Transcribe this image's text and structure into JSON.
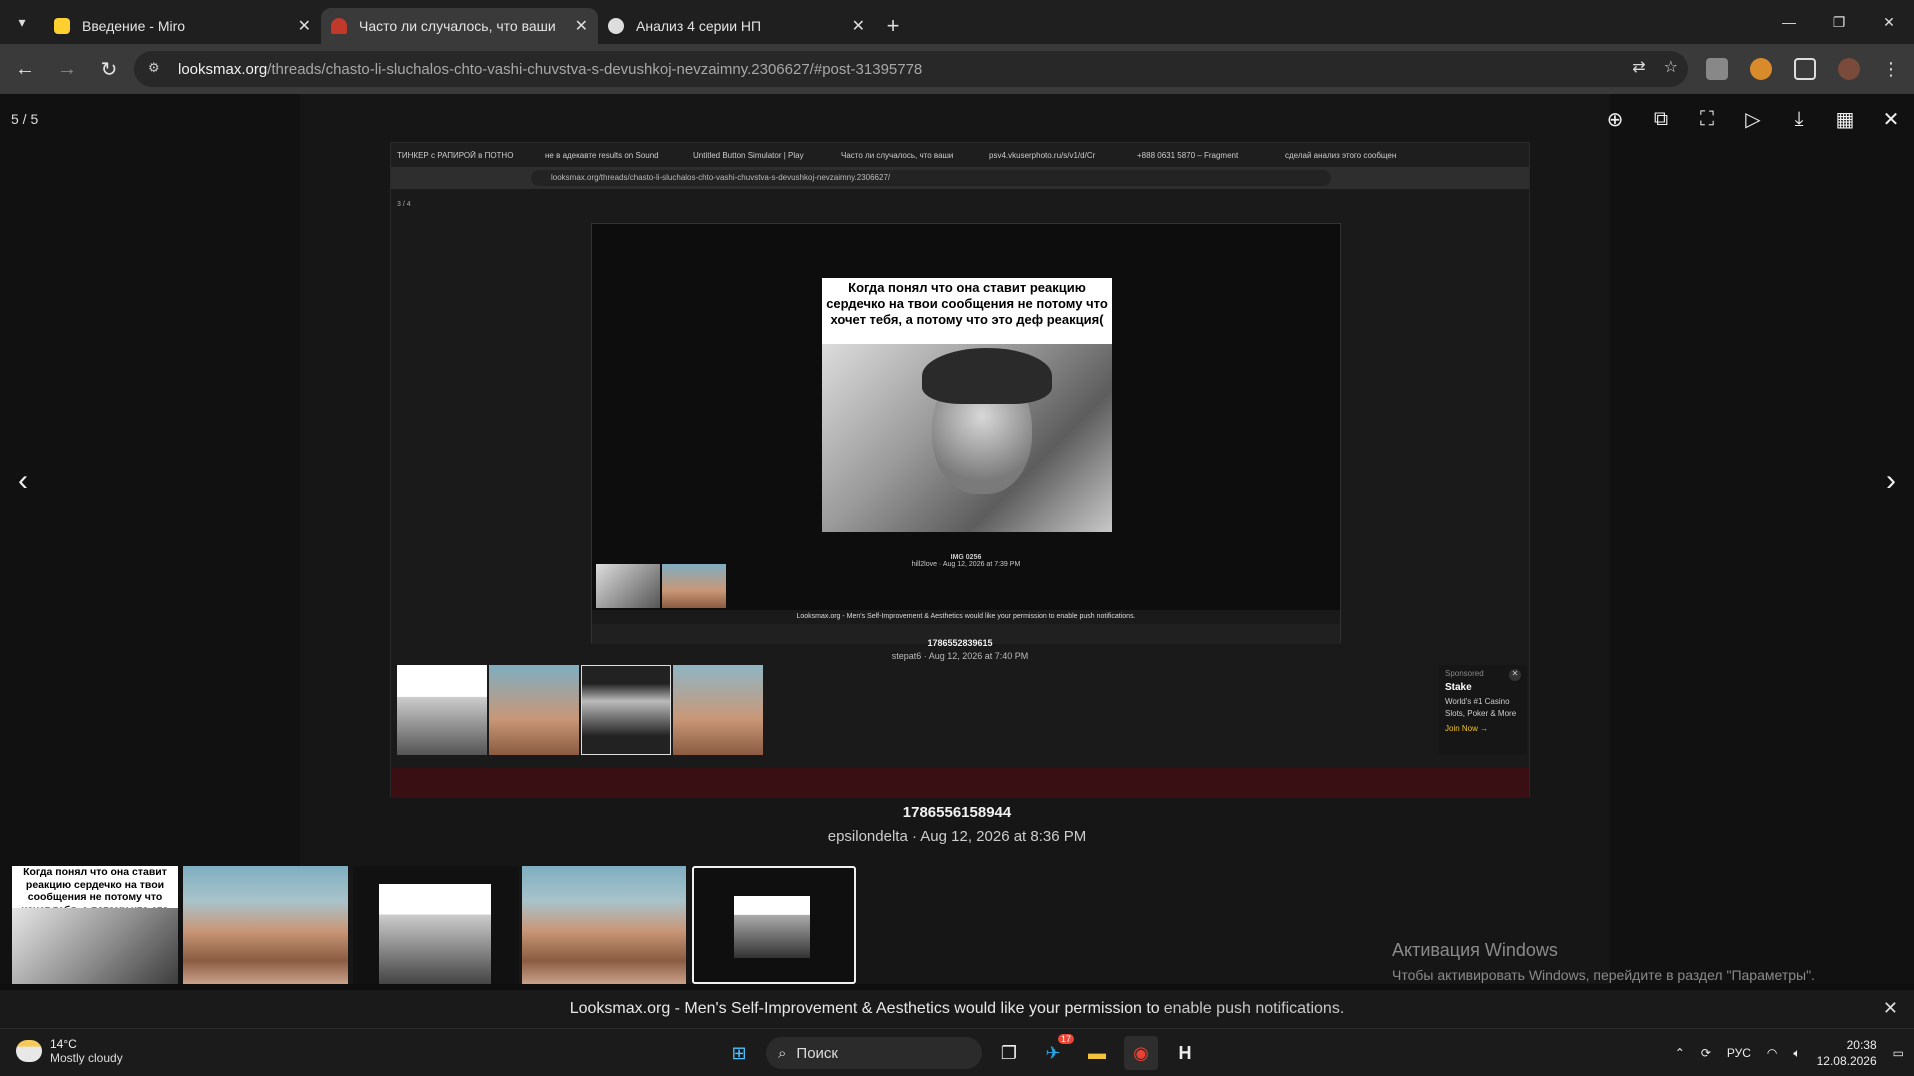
{
  "browser": {
    "tabs": [
      {
        "title": "Введение - Miro",
        "favicon_color": "#ffd02f",
        "active": false
      },
      {
        "title": "Часто ли случалось, что ваши",
        "favicon_color": "#c0392b",
        "active": true
      },
      {
        "title": "Анализ 4 серии НП",
        "favicon_color": "#dddddd",
        "active": false
      }
    ],
    "url_host": "looksmax.org",
    "url_path": "/threads/chasto-li-sluchalos-chto-vashi-chuvstva-s-devushkoj-nevzaimny.2306627/#post-31395778"
  },
  "viewer": {
    "counter": "5 / 5",
    "caption_title": "1786556158944",
    "caption_sub": "epsilondelta · Aug 12, 2026 at 8:36 PM"
  },
  "inner_screenshot": {
    "tabs": [
      "ТИНКЕР с РАПИРОЙ в ПОТНО",
      "не в адекавте results on Sound",
      "Untitled Button Simulator | Play",
      "Часто ли случалось, что ваши",
      "psv4.vkuserphoto.ru/s/v1/d/Cr",
      "+888 0631 5870 – Fragment",
      "сделай анализ этого сообщен"
    ],
    "url": "looksmax.org/threads/chasto-li-sluchalos-chto-vashi-chuvstva-s-devushkoj-nevzaimny.2306627/",
    "counter": "3 / 4",
    "meme_text": "Когда понял что она ставит реакцию сердечко на твои сообщения не потому что хочет тебя, а потому что это деф реакция(",
    "inner_caption_title": "IMG 0256",
    "inner_caption_sub": "hill2love · Aug 12, 2026 at 7:39 PM",
    "inner_notif": "Looksmax.org - Men's Self-Improvement & Aesthetics would like your permission to enable push notifications.",
    "mid_caption_title": "1786552839615",
    "mid_caption_sub": "stepat6 · Aug 12, 2026 at 7:40 PM",
    "ad": {
      "label": "Sponsored",
      "brand": "Stake",
      "line1": "World's #1 Casino",
      "line2": "Slots, Poker & More",
      "cta": "Join Now →"
    }
  },
  "thumb_meme_text": "Когда понял что она ставит реакцию сердечко на твои сообщения не потому что хочет тебя, а потому что это деф реакция(",
  "activation": {
    "title": "Активация Windows",
    "subtitle": "Чтобы активировать Windows, перейдите в раздел \"Параметры\"."
  },
  "notification": {
    "text": "Looksmax.org - Men's Self-Improvement & Aesthetics would like your permission to",
    "link": "enable push notifications."
  },
  "taskbar": {
    "weather_temp": "14°C",
    "weather_cond": "Mostly cloudy",
    "search_placeholder": "Поиск",
    "telegram_badge": "17",
    "lang": "РУС",
    "time": "20:38",
    "date": "12.08.2026"
  }
}
